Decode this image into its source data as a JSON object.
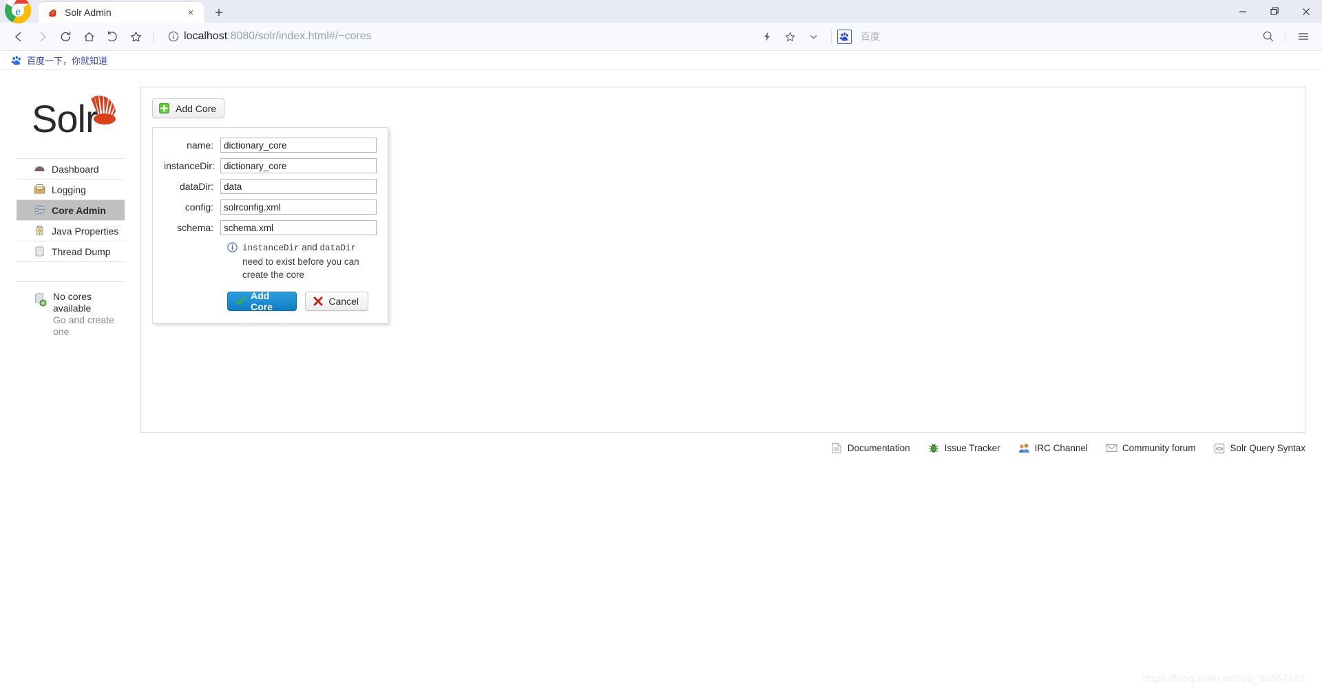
{
  "browser": {
    "tab": {
      "title": "Solr Admin",
      "favicon": "solr-favicon",
      "close_label": "×"
    },
    "newtab_label": "+",
    "window_controls": {
      "minimize": "—",
      "restore": "❐",
      "close": "✕"
    },
    "nav": {
      "back": "back-arrow",
      "forward": "forward-arrow",
      "reload": "reload-arrow",
      "home": "home-icon",
      "history": "history-arrow",
      "bookmark_star": "star-icon"
    },
    "omnibox": {
      "info_icon": "info-circle-icon",
      "url_host": "localhost",
      "url_rest": ":8080/solr/index.html#/~cores",
      "full_url": "localhost:8080/solr/index.html#/~cores"
    },
    "omnibox_right": {
      "lightning_icon": "lightning-icon",
      "star_icon": "star-icon",
      "chevron_icon": "chevron-down-icon",
      "search_engine_label": "百度",
      "search_icon": "search-icon",
      "menu_icon": "hamburger-menu-icon"
    },
    "bookmarks": [
      {
        "label": "百度一下，你就知道",
        "icon": "baidu-paw-icon"
      }
    ]
  },
  "solr": {
    "logo_text": "Solr",
    "sidebar": {
      "items": [
        {
          "label": "Dashboard",
          "icon": "dashboard-icon",
          "active": false
        },
        {
          "label": "Logging",
          "icon": "logging-icon",
          "active": false
        },
        {
          "label": "Core Admin",
          "icon": "core-admin-icon",
          "active": true
        },
        {
          "label": "Java Properties",
          "icon": "java-properties-icon",
          "active": false
        },
        {
          "label": "Thread Dump",
          "icon": "thread-dump-icon",
          "active": false
        }
      ],
      "cores_status": {
        "title": "No cores available",
        "subtitle": "Go and create one",
        "icon": "core-add-icon"
      }
    },
    "toolbar": {
      "add_core_label": "Add Core",
      "add_core_icon": "green-plus-icon"
    },
    "add_core_form": {
      "fields": [
        {
          "label": "name:",
          "value": "dictionary_core",
          "name": "name"
        },
        {
          "label": "instanceDir:",
          "value": "dictionary_core",
          "name": "instanceDir"
        },
        {
          "label": "dataDir:",
          "value": "data",
          "name": "dataDir"
        },
        {
          "label": "config:",
          "value": "solrconfig.xml",
          "name": "config"
        },
        {
          "label": "schema:",
          "value": "schema.xml",
          "name": "schema"
        }
      ],
      "hint": {
        "icon": "info-icon",
        "code1": "instanceDir",
        "mid": " and ",
        "code2": "dataDir",
        "tail": " need to exist before you can create the core"
      },
      "submit_label": "Add Core",
      "submit_icon": "green-check-icon",
      "cancel_label": "Cancel",
      "cancel_icon": "red-x-icon"
    },
    "footer_links": [
      {
        "label": "Documentation",
        "icon": "document-icon"
      },
      {
        "label": "Issue Tracker",
        "icon": "bug-icon"
      },
      {
        "label": "IRC Channel",
        "icon": "people-icon"
      },
      {
        "label": "Community forum",
        "icon": "envelope-icon"
      },
      {
        "label": "Solr Query Syntax",
        "icon": "code-icon"
      }
    ]
  },
  "watermark": "https://blog.csdn.net/qq_36367121",
  "colors": {
    "accent_blue": "#1a8fd4",
    "solr_red": "#d9411e",
    "active_nav_bg": "#c0c0c0",
    "link_blue": "#3b4ab0"
  }
}
